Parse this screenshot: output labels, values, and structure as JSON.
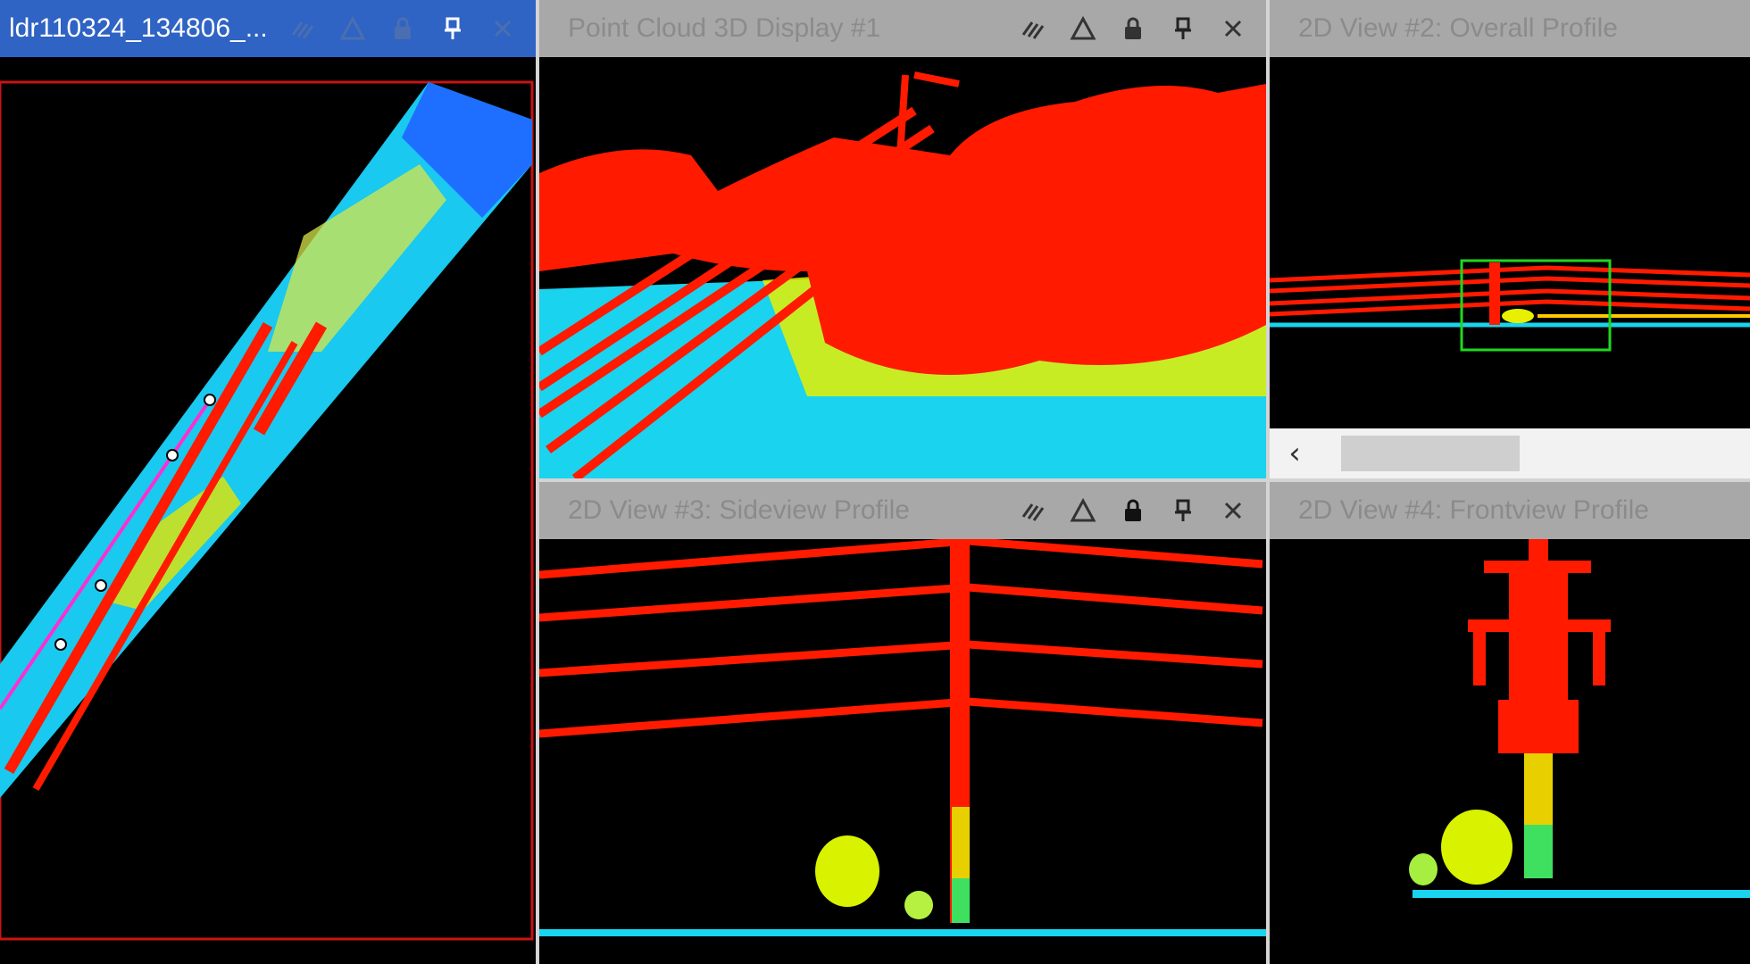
{
  "panels": {
    "left": {
      "title": "ldr110324_134806_...",
      "active": true
    },
    "p3d": {
      "title": "Point Cloud 3D Display #1"
    },
    "overall": {
      "title": "2D View #2: Overall Profile"
    },
    "side": {
      "title": "2D View #3: Sideview Profile"
    },
    "front": {
      "title": "2D View #4: Frontview Profile"
    }
  },
  "icons": {
    "sync": "link-sync-icon",
    "triangle": "triangle-warning-icon",
    "lock": "lock-icon",
    "pin": "pin-icon",
    "close": "close-icon",
    "scroll_left": "chevron-left-icon"
  },
  "colors": {
    "active_title": "#2f63c4",
    "inactive_title": "#a8a8a8",
    "inactive_text": "#8b8b8b",
    "point_high": "#ff1a00",
    "point_mid": "#e6ff00",
    "point_low": "#00e5ff",
    "selection_box": "#1fd81f",
    "route_line": "#ff2fd0"
  },
  "scroll": {
    "arrow_label": "‹"
  }
}
